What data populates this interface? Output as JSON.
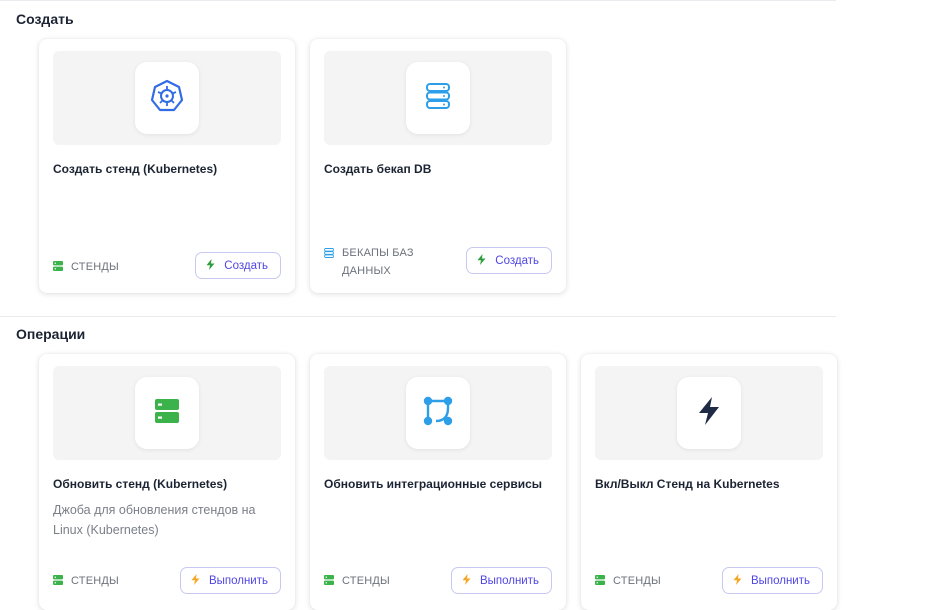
{
  "sections": {
    "create": {
      "title": "Создать",
      "cards": [
        {
          "title": "Создать стенд (Kubernetes)",
          "icon": "kubernetes-icon",
          "tag": "СТЕНДЫ",
          "tag_icon": "server-green-icon",
          "action_label": "Создать",
          "action_icon": "bolt-green-icon"
        },
        {
          "title": "Создать бекап DB",
          "icon": "database-icon",
          "tag": "БЕКАПЫ БАЗ ДАННЫХ",
          "tag_line1": "БЕКАПЫ БАЗ",
          "tag_line2": "ДАННЫХ",
          "tag_icon": "database-small-icon",
          "action_label": "Создать",
          "action_icon": "bolt-green-icon"
        }
      ]
    },
    "operations": {
      "title": "Операции",
      "cards": [
        {
          "title": "Обновить стенд (Kubernetes)",
          "description": "Джоба для обновления стендов на Linux (Kubernetes)",
          "desc_line1": "Джоба для обновления стендов на",
          "desc_line2": "Linux (Kubernetes)",
          "icon": "server-stack-icon",
          "tag": "СТЕНДЫ",
          "tag_icon": "server-green-icon",
          "action_label": "Выполнить",
          "action_icon": "bolt-orange-icon"
        },
        {
          "title": "Обновить интеграционные сервисы",
          "icon": "git-branch-icon",
          "tag": "СТЕНДЫ",
          "tag_icon": "server-green-icon",
          "action_label": "Выполнить",
          "action_icon": "bolt-orange-icon"
        },
        {
          "title": "Вкл/Выкл Стенд на Kubernetes",
          "icon": "bolt-dark-icon",
          "tag": "СТЕНДЫ",
          "tag_icon": "server-green-icon",
          "action_label": "Выполнить",
          "action_icon": "bolt-orange-icon"
        }
      ]
    }
  },
  "colors": {
    "accent": "#4f46e5",
    "button_border": "#c7c9f3",
    "green": "#3bb34a",
    "orange": "#f5a623",
    "blue_k8s": "#326ce5",
    "blue_db": "#2d9ee8",
    "dark": "#1f2a44"
  }
}
